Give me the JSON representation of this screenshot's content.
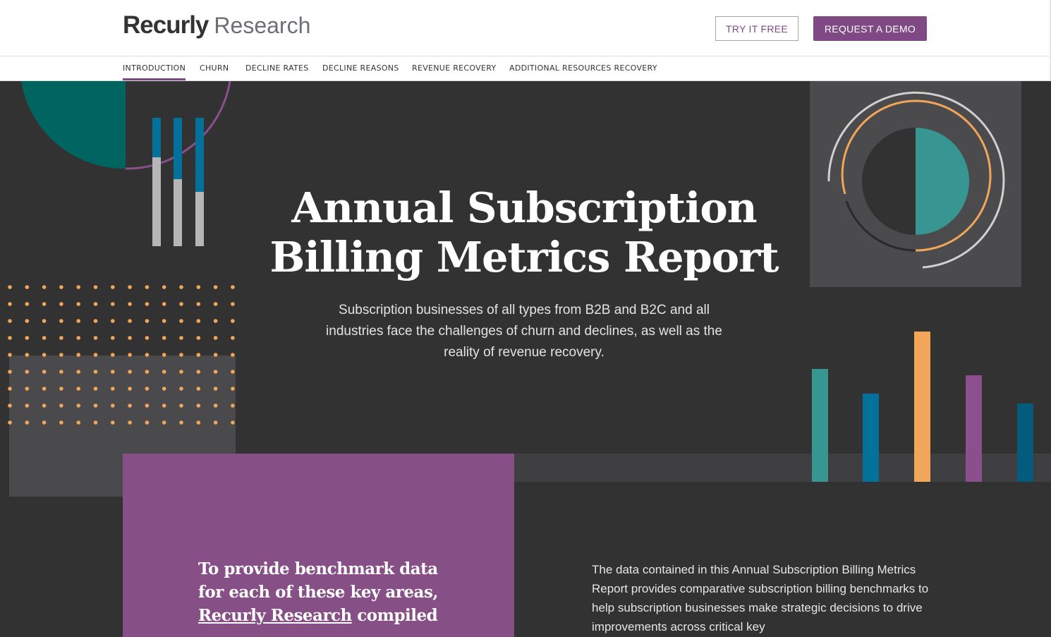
{
  "header": {
    "logo_brand": "Recurly",
    "logo_sub": "Research",
    "try_free_label": "TRY IT FREE",
    "request_demo_label": "REQUEST A DEMO"
  },
  "nav": {
    "items": [
      {
        "label": "INTRODUCTION",
        "active": true
      },
      {
        "label": "CHURN"
      },
      {
        "label": "DECLINE RATES"
      },
      {
        "label": "DECLINE REASONS"
      },
      {
        "label": "REVENUE RECOVERY"
      },
      {
        "label": "ADDITIONAL RESOURCES RECOVERY"
      }
    ]
  },
  "hero": {
    "title_line1": "Annual Subscription",
    "title_line2": "Billing Metrics Report",
    "subtitle": "Subscription businesses of all types from B2B and B2C and all industries face the challenges of churn and declines, as well as the reality of revenue recovery."
  },
  "intro": {
    "quote_before": "To provide benchmark data for each of these key areas, ",
    "quote_link": "Recurly Research",
    "quote_after": " compiled",
    "body": "The data contained in this Annual Subscription Billing Metrics Report provides comparative subscription billing benchmarks to help subscription businesses make strategic decisions to drive improvements across critical key"
  },
  "colors": {
    "brand_purple": "#7f4983",
    "teal": "#006461",
    "light_teal": "#379592",
    "blue": "#03719a",
    "orange": "#f1a65a",
    "background": "#333233"
  }
}
